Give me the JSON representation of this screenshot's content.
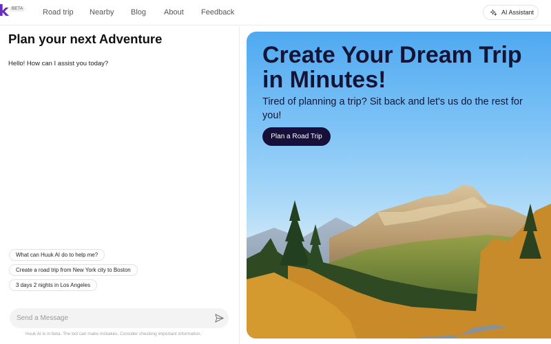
{
  "header": {
    "logo_text": "k",
    "beta_badge": "BETA",
    "nav": [
      "Road trip",
      "Nearby",
      "Blog",
      "About",
      "Feedback"
    ],
    "ai_button_label": "AI Assistant",
    "ai_button_icon": "sparkle-icon"
  },
  "chat": {
    "title": "Plan your next Adventure",
    "greeting": "Hello! How can I assist you today?",
    "suggestions": [
      "What can Huuk AI do to help me?",
      "Create a road trip from New York city to Boston",
      "3 days 2 nights in Los Angeles"
    ],
    "input_placeholder": "Send a Message",
    "input_value": "",
    "send_icon": "send-icon",
    "disclaimer": "Huuk AI is in beta. The bot can make mistakes. Consider checking important information."
  },
  "hero": {
    "title": "Create Your Dream Trip in Minutes!",
    "subtitle": "Tired of planning a trip? Sit back and let's us do the rest for you!",
    "cta_label": "Plan a Road Trip",
    "cta_color": "#17103a",
    "title_color": "#141436"
  },
  "colors": {
    "brand": "#6a2bbf",
    "sky_top": "#4fa9f0"
  }
}
